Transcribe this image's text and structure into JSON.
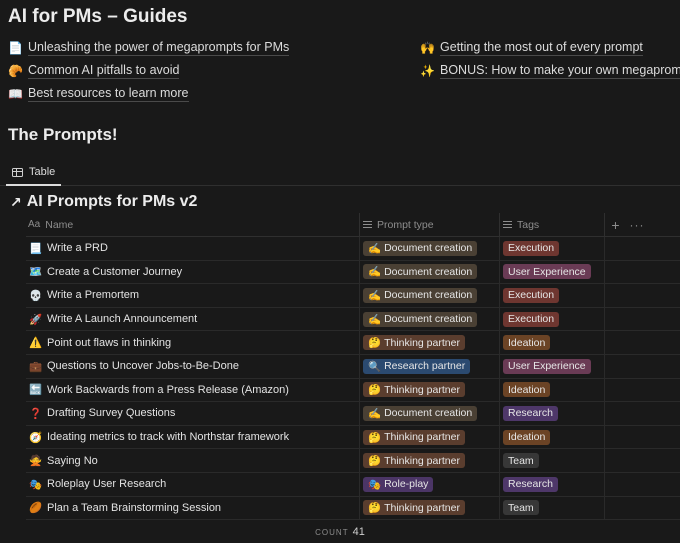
{
  "page": {
    "title": "AI for PMs – Guides"
  },
  "guides": [
    {
      "icon": "📄",
      "icon_name": "page-icon",
      "label": "Unleashing the power of megaprompts for PMs"
    },
    {
      "icon": "🥐",
      "icon_name": "croissant-icon",
      "label": "Common AI pitfalls to avoid"
    },
    {
      "icon": "📖",
      "icon_name": "book-icon",
      "label": "Best resources to learn more"
    },
    {
      "icon": "🙌",
      "icon_name": "raised-hands-icon",
      "label": "Getting the most out of every prompt"
    },
    {
      "icon": "✨",
      "icon_name": "sparkles-icon",
      "label": "BONUS: How to make your own megaprompts"
    }
  ],
  "prompts_section": {
    "title": "The Prompts!"
  },
  "view_tab": {
    "label": "Table"
  },
  "database": {
    "arrow": "↗",
    "title": "AI Prompts for PMs v2"
  },
  "columns": {
    "name_prefix": "Aa",
    "name": "Name",
    "prompt_type": "Prompt type",
    "tags": "Tags",
    "add": "+",
    "more": "···"
  },
  "colors": {
    "Document creation": "#4a4034",
    "Thinking partner": "#5a3d2e",
    "Research partner": "#2b4a70",
    "Role-play": "#4b3566",
    "Execution": "#6e3630",
    "User Experience": "#6a3b55",
    "Ideation": "#6b4325",
    "Research": "#4e3769",
    "Team": "#373737"
  },
  "type_icons": {
    "Document creation": "✍️",
    "Thinking partner": "🤔",
    "Research partner": "🔍",
    "Role-play": "🎭"
  },
  "rows": [
    {
      "icon": "📃",
      "name": "Write a PRD",
      "type": "Document creation",
      "tag": "Execution"
    },
    {
      "icon": "🗺️",
      "name": "Create a Customer Journey",
      "type": "Document creation",
      "tag": "User Experience"
    },
    {
      "icon": "💀",
      "name": "Write a Premortem",
      "type": "Document creation",
      "tag": "Execution"
    },
    {
      "icon": "🚀",
      "name": "Write A Launch Announcement",
      "type": "Document creation",
      "tag": "Execution"
    },
    {
      "icon": "⚠️",
      "name": "Point out flaws in thinking",
      "type": "Thinking partner",
      "tag": "Ideation"
    },
    {
      "icon": "💼",
      "name": "Questions to Uncover Jobs-to-Be-Done",
      "type": "Research partner",
      "tag": "User Experience"
    },
    {
      "icon": "🔙",
      "name": "Work Backwards from a Press Release (Amazon)",
      "type": "Thinking partner",
      "tag": "Ideation"
    },
    {
      "icon": "❓",
      "name": "Drafting Survey Questions",
      "type": "Document creation",
      "tag": "Research"
    },
    {
      "icon": "🧭",
      "name": "Ideating metrics to track with Northstar framework",
      "type": "Thinking partner",
      "tag": "Ideation"
    },
    {
      "icon": "🙅",
      "name": "Saying No",
      "type": "Thinking partner",
      "tag": "Team"
    },
    {
      "icon": "🎭",
      "name": "Roleplay User Research",
      "type": "Role-play",
      "tag": "Research"
    },
    {
      "icon": "🏉",
      "name": "Plan a Team Brainstorming Session",
      "type": "Thinking partner",
      "tag": "Team"
    }
  ],
  "footer": {
    "count_label": "COUNT",
    "count_value": "41"
  }
}
